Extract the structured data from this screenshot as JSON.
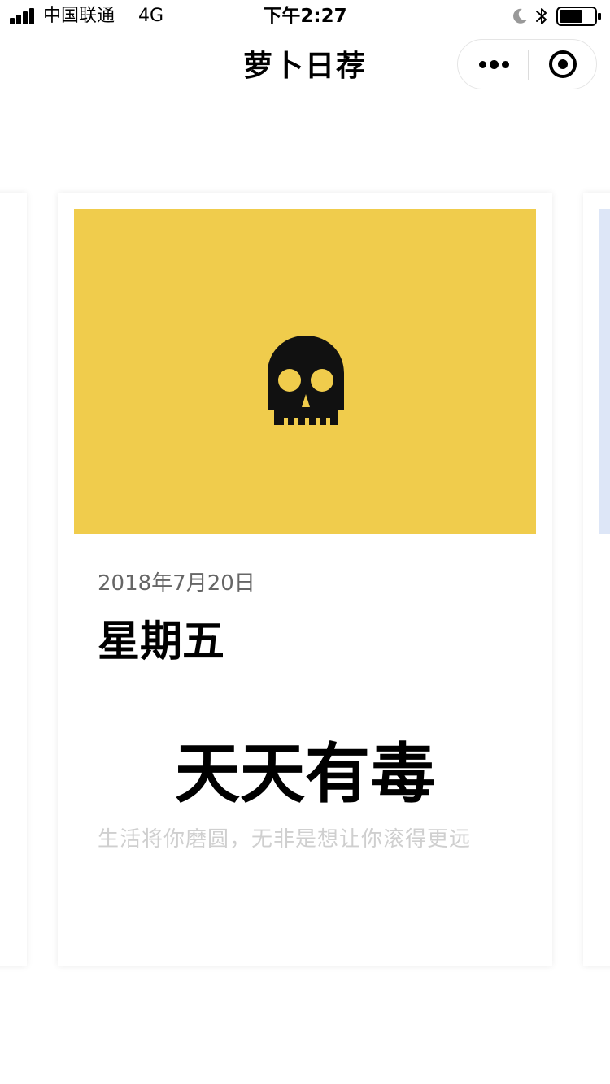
{
  "status_bar": {
    "carrier": "中国联通",
    "network": "4G",
    "time": "下午2:27"
  },
  "nav": {
    "title": "萝卜日荐"
  },
  "card": {
    "date": "2018年7月20日",
    "weekday": "星期五",
    "headline": "天天有毒",
    "quote": "生活将你磨圆，无非是想让你滚得更远",
    "cover_icon": "skull-icon",
    "cover_color": "#F0CC4C"
  },
  "next_card": {
    "cover_color": "#DDE6F7"
  }
}
